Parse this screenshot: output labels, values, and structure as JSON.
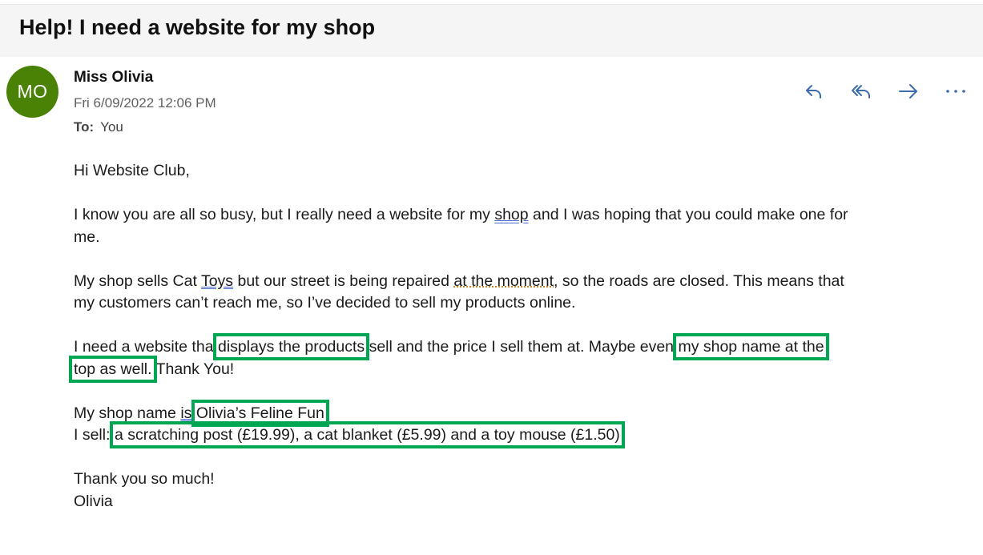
{
  "subject": "Help! I need a website for my shop",
  "sender": {
    "initials": "MO",
    "name": "Miss Olivia",
    "date": "Fri 6/09/2022 12:06 PM",
    "to_label": "To:",
    "to_value": "You"
  },
  "actions": [
    "reply-icon",
    "reply-all-icon",
    "forward-icon",
    "more-icon"
  ],
  "colors": {
    "avatar": "#498205",
    "highlight_box": "#00a651",
    "action_icon": "#3b6cae"
  },
  "body": {
    "greeting": "Hi Website Club,",
    "p1_a": "I know you are all so busy, but I really need a website for my ",
    "p1_shop": "shop",
    "p1_b": " and I was hoping that you could make one for",
    "p1_c": "me.",
    "p2_a": "My shop sells Cat ",
    "p2_toys": "Toys",
    "p2_b": " but our street is being repaired ",
    "p2_moment": "at the moment",
    "p2_c": ", so the roads are closed. This means that",
    "p2_d": "my customers can’t reach me, so I’ve decided to sell my products online.",
    "p3_a": "I need a website tha",
    "p3_hl1": "displays the products",
    "p3_b": " sell and the price I sell them at. Maybe even",
    "p3_hl2a": "my shop name at the",
    "p3_hl2b": "top as well.",
    "p3_c": " Thank You!",
    "p4_a": "My shop name ",
    "p4_is": "is",
    "p4_hl": "Olivia’s Feline Fun",
    "p4_b": "I sell:",
    "p4_hl2": "a scratching post (£19.99), a cat blanket (£5.99) and a toy mouse (£1.50)",
    "closing": "Thank you so much!",
    "signature": "Olivia"
  }
}
